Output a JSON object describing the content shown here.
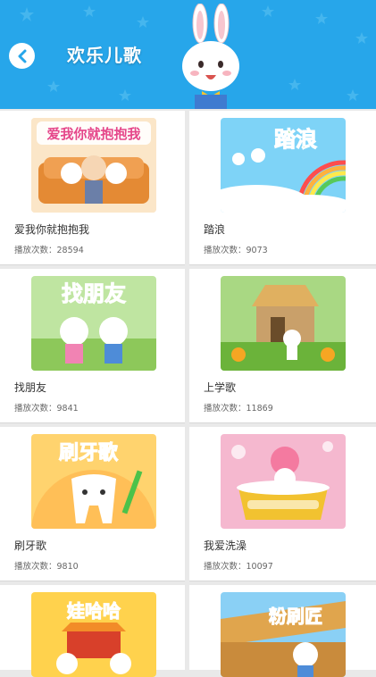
{
  "header": {
    "title": "欢乐儿歌",
    "bg_color": "#27a6ea"
  },
  "songs": [
    {
      "title": "爱我你就抱抱我",
      "plays_label": "播放次数：",
      "plays": "28594",
      "banner": "爱我你就抱抱我"
    },
    {
      "title": "踏浪",
      "plays_label": "播放次数：",
      "plays": "9073",
      "banner": "踏浪"
    },
    {
      "title": "找朋友",
      "plays_label": "播放次数：",
      "plays": "9841",
      "banner": "找朋友"
    },
    {
      "title": "上学歌",
      "plays_label": "播放次数：",
      "plays": "11869",
      "banner": ""
    },
    {
      "title": "刷牙歌",
      "plays_label": "播放次数：",
      "plays": "9810",
      "banner": "刷牙歌"
    },
    {
      "title": "我爱洗澡",
      "plays_label": "播放次数：",
      "plays": "10097",
      "banner": ""
    },
    {
      "title": "",
      "plays_label": "",
      "plays": "",
      "banner": "娃哈哈"
    },
    {
      "title": "",
      "plays_label": "",
      "plays": "",
      "banner": "粉刷匠"
    }
  ]
}
